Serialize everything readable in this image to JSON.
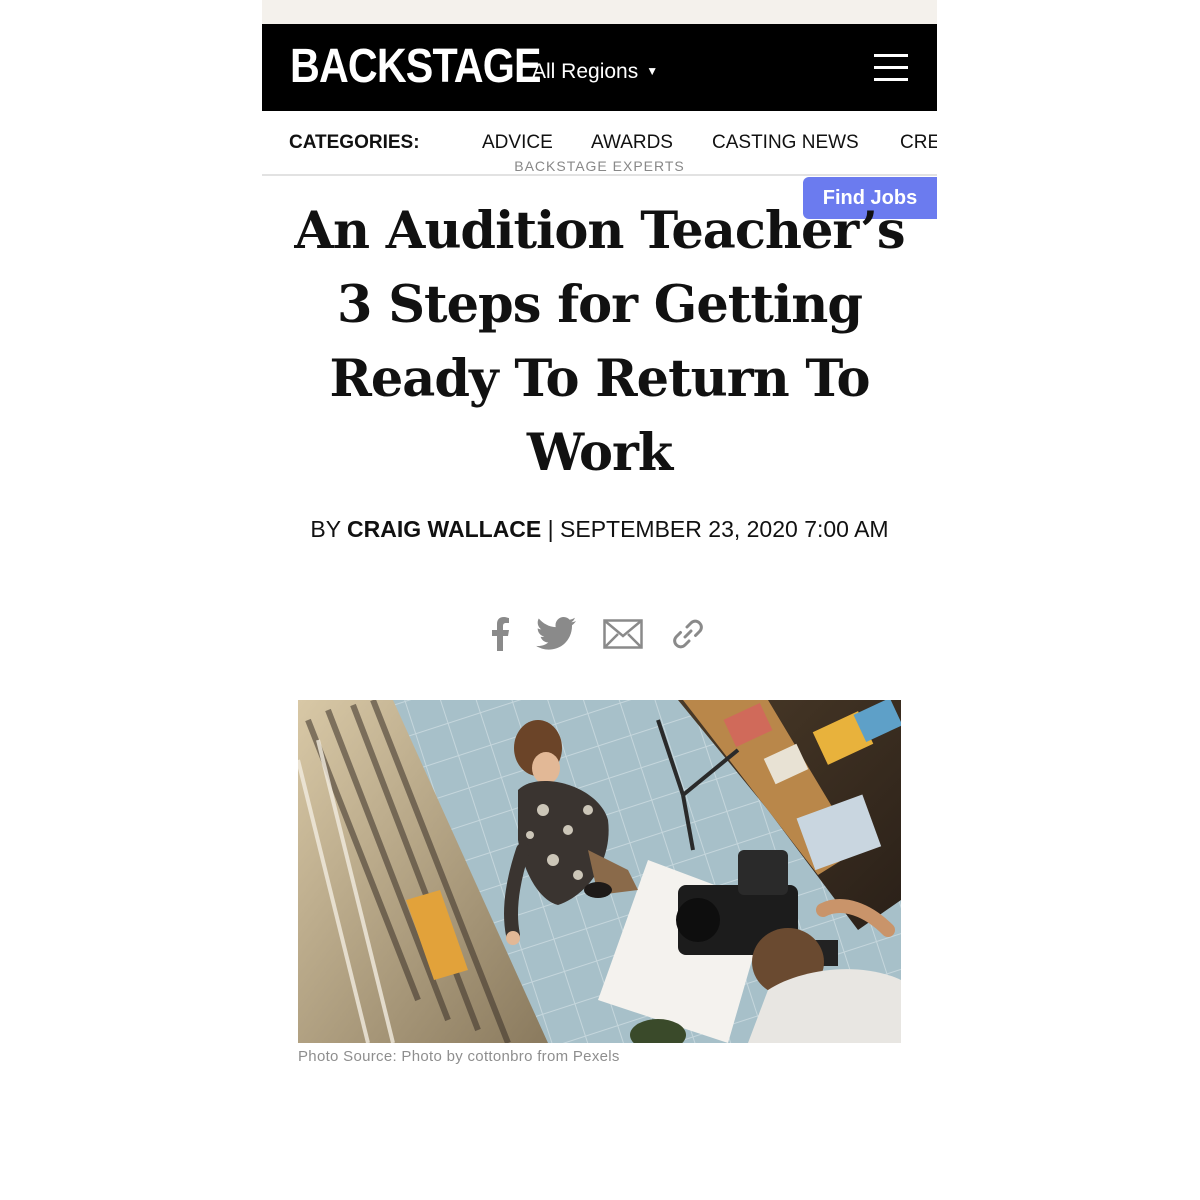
{
  "header": {
    "logo": "BACKSTAGE",
    "region": "All Regions"
  },
  "categories": {
    "label": "CATEGORIES:",
    "items": [
      "ADVICE",
      "AWARDS",
      "CASTING NEWS",
      "CRE"
    ]
  },
  "article": {
    "kicker": "BACKSTAGE EXPERTS",
    "find_jobs": "Find Jobs",
    "title": "An Audition Teacher’s 3 Steps for Getting Ready To Return To Work",
    "byline_prefix": "BY ",
    "author": "CRAIG WALLACE",
    "byline_date": " | SEPTEMBER 23, 2020 7:00 AM",
    "share_icons": [
      "facebook-icon",
      "twitter-icon",
      "email-icon",
      "link-icon"
    ],
    "caption": "Photo Source: Photo by cottonbro from Pexels"
  },
  "colors": {
    "masthead": "#000000",
    "find_jobs_bg": "#6b7bef",
    "share_icon": "#8a8a8a"
  }
}
